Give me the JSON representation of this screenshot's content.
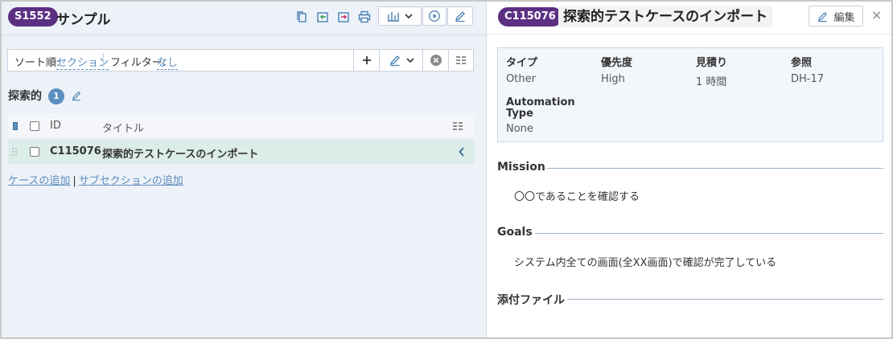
{
  "left": {
    "badge": "S1552",
    "title": "サンプル",
    "filter": {
      "sort_label": "ソート順:",
      "sort_value": "セクション",
      "filter_label": "フィルター:",
      "filter_value": "なし"
    },
    "section": {
      "name": "探索的",
      "count": "1"
    },
    "table": {
      "headers": {
        "id": "ID",
        "title": "タイトル"
      },
      "rows": [
        {
          "id": "C115076",
          "title": "探索的テストケースのインポート"
        }
      ]
    },
    "add_case": "ケースの追加",
    "separator": "|",
    "add_subsection": "サブセクションの追加"
  },
  "right": {
    "badge": "C115076",
    "title": "探索的テストケースのインポート",
    "edit_label": "編集",
    "close": "×",
    "props": {
      "type_label": "タイプ",
      "type_value": "Other",
      "priority_label": "優先度",
      "priority_value": "High",
      "estimate_label": "見積り",
      "estimate_value": "1 時間",
      "ref_label": "参照",
      "ref_value": "DH-17",
      "automation_label_1": "Automation",
      "automation_label_2": "Type",
      "automation_value": "None"
    },
    "mission": {
      "heading": "Mission",
      "text": "〇〇であることを確認する"
    },
    "goals": {
      "heading": "Goals",
      "text": "システム内全ての画面(全XX画面)で確認が完了している"
    },
    "attachments": {
      "heading": "添付ファイル"
    }
  },
  "colors": {
    "badge": "#5b2f82",
    "link": "#5c8dbf",
    "selected_row": "#dcece8"
  }
}
